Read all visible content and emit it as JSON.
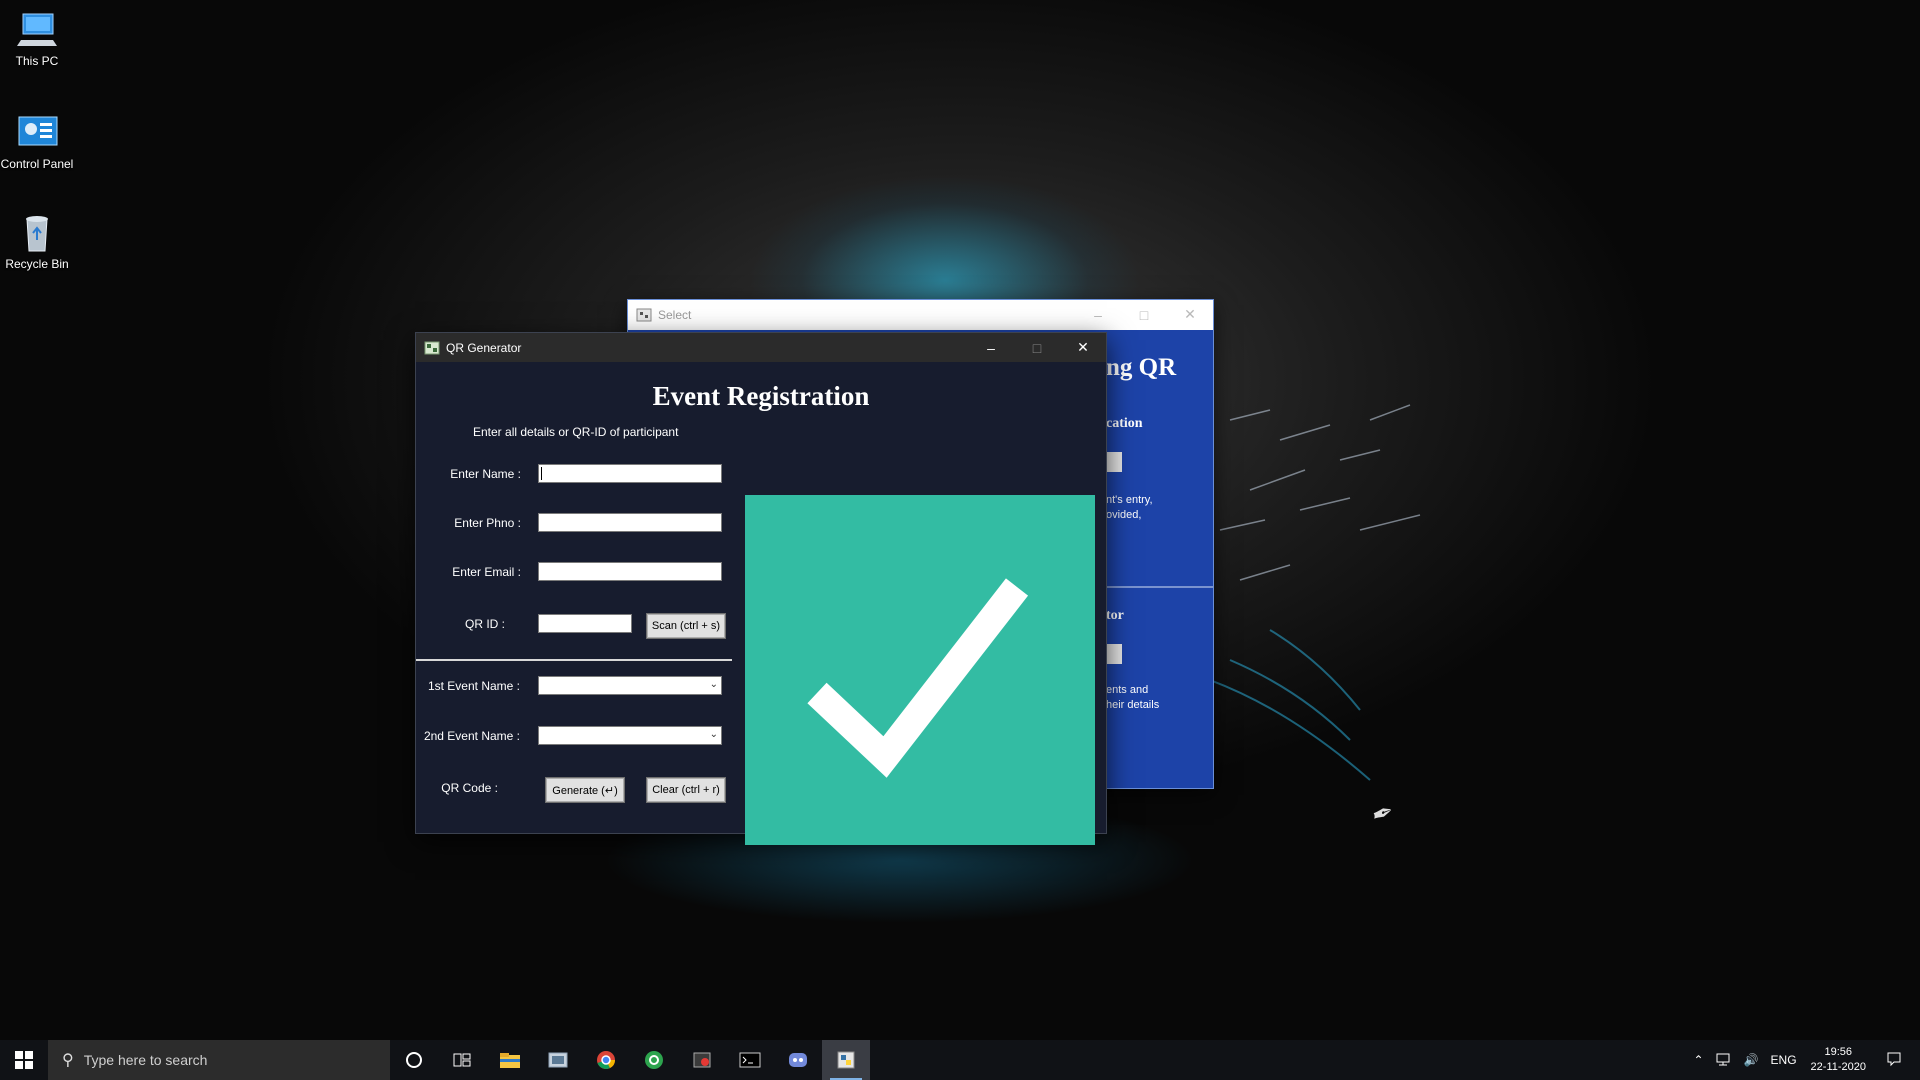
{
  "desktop": {
    "icons": [
      {
        "label": "This PC"
      },
      {
        "label": "Control Panel"
      },
      {
        "label": "Recycle Bin"
      }
    ]
  },
  "back_window": {
    "title": "Select",
    "heading_fragment": "ng QR",
    "section1_fragment": "cation",
    "section1_desc": [
      "nt's entry,",
      "ovided,"
    ],
    "section2_fragment": "tor",
    "section2_desc": [
      "ents and",
      "heir details"
    ]
  },
  "app": {
    "window_title": "QR Generator",
    "title": "Event Registration",
    "subtitle": "Enter all details or QR-ID of participant",
    "labels": {
      "name": "Enter Name :",
      "phone": "Enter Phno :",
      "email": "Enter Email :",
      "qr_id": "QR ID :",
      "event1": "1st Event Name :",
      "event2": "2nd Event Name :",
      "qr_code": "QR Code :"
    },
    "values": {
      "name": "",
      "phone": "",
      "email": "",
      "qr_id": "",
      "event1": "",
      "event2": ""
    },
    "buttons": {
      "scan": "Scan (ctrl + s)",
      "generate": "Generate (↵)",
      "clear": "Clear (ctrl + r)"
    },
    "colors": {
      "background": "#171c2e",
      "qr_panel": "#33bca3",
      "check": "#ffffff"
    }
  },
  "taskbar": {
    "search_placeholder": "Type here to search",
    "apps": [
      "cortana-icon",
      "task-view-icon",
      "file-explorer-icon",
      "photos-icon",
      "chrome-icon",
      "browser-icon",
      "media-icon",
      "terminal-icon",
      "discord-icon",
      "python-qr-app-icon"
    ],
    "language": "ENG",
    "time": "19:56",
    "date": "22-11-2020"
  }
}
